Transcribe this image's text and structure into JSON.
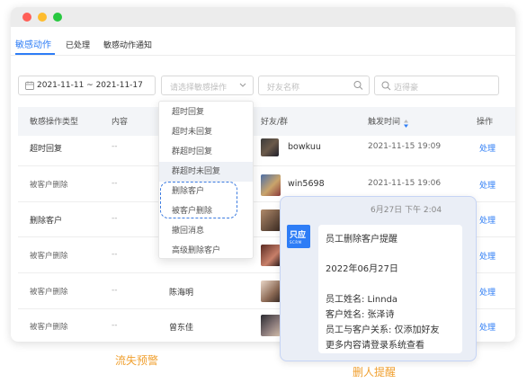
{
  "tabs": [
    {
      "label": "敏感动作",
      "active": true
    },
    {
      "label": "已处理",
      "active": false
    },
    {
      "label": "敏感动作通知",
      "active": false
    }
  ],
  "filters": {
    "date_range": "2021-11-11 ~ 2021-11-17",
    "action_placeholder": "请选择敏感操作",
    "friend_placeholder": "好友名称",
    "employee_placeholder": "迈得豪"
  },
  "table": {
    "headers": [
      "敏感操作类型",
      "内容",
      "好友/群",
      "触发时间",
      "操作"
    ],
    "rows": [
      {
        "type": "超时回复",
        "content": "--",
        "name": "",
        "friend": "bowkuu",
        "time": "2021-11-15 19:09",
        "action": "处理"
      },
      {
        "type": "被客户删除",
        "content": "--",
        "name": "",
        "friend": "win5698",
        "time": "2021-11-15 19:06",
        "action": "处理"
      },
      {
        "type": "删除客户",
        "content": "--",
        "name": "",
        "friend": "",
        "time": "",
        "action": "处理"
      },
      {
        "type": "被客户删除",
        "content": "--",
        "name": "",
        "friend": "",
        "time": "",
        "action": "处理"
      },
      {
        "type": "被客户删除",
        "content": "--",
        "name": "陈海明",
        "friend": "",
        "time": "",
        "action": "处理"
      },
      {
        "type": "被客户删除",
        "content": "--",
        "name": "曾东佳",
        "friend": "",
        "time": "",
        "action": "处理"
      }
    ]
  },
  "dropdown": {
    "items": [
      "超时回复",
      "超时未回复",
      "群超时回复",
      "群超时未回复",
      "删除客户",
      "被客户删除",
      "撤回消息",
      "高级删除客户"
    ],
    "highlighted_index": 3
  },
  "notification": {
    "timestamp": "6月27日 下午 2:04",
    "app_name": "只应",
    "app_sub": "SCRM",
    "title": "员工删除客户提醒",
    "date": "2022年06月27日",
    "line_employee": "员工姓名: Linnda",
    "line_customer": "客户姓名: 张泽诗",
    "line_relation": "员工与客户关系: 仅添加好友",
    "line_more": "更多内容请登录系统查看"
  },
  "captions": {
    "left": "流失预警",
    "right": "删人提醒"
  },
  "colors": {
    "accent": "#2e7df6",
    "caption": "#f0a030"
  }
}
